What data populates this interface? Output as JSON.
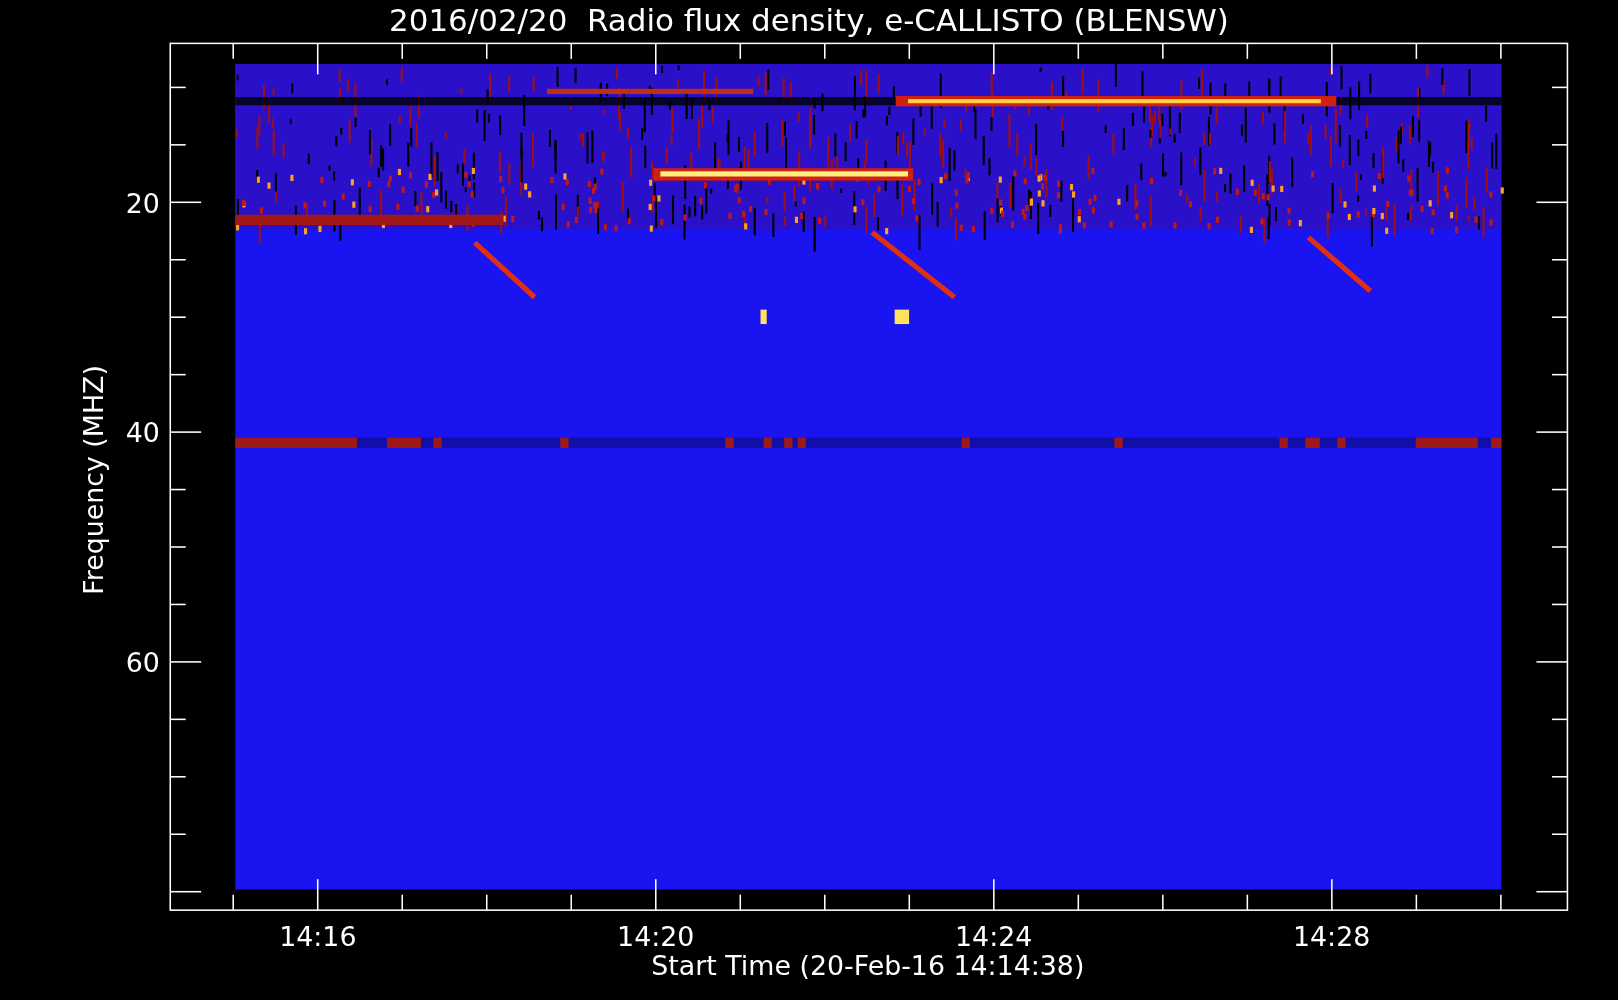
{
  "chart": {
    "title": "2016/02/20  Radio flux density, e-CALLISTO (BLENSW)",
    "ylabel": "Frequency (MHZ)",
    "xlabel": "Start Time (20-Feb-16 14:14:38)",
    "yticks": [
      "20",
      "40",
      "60"
    ],
    "xticks": [
      "14:16",
      "14:20",
      "14:24",
      "14:28"
    ]
  }
}
